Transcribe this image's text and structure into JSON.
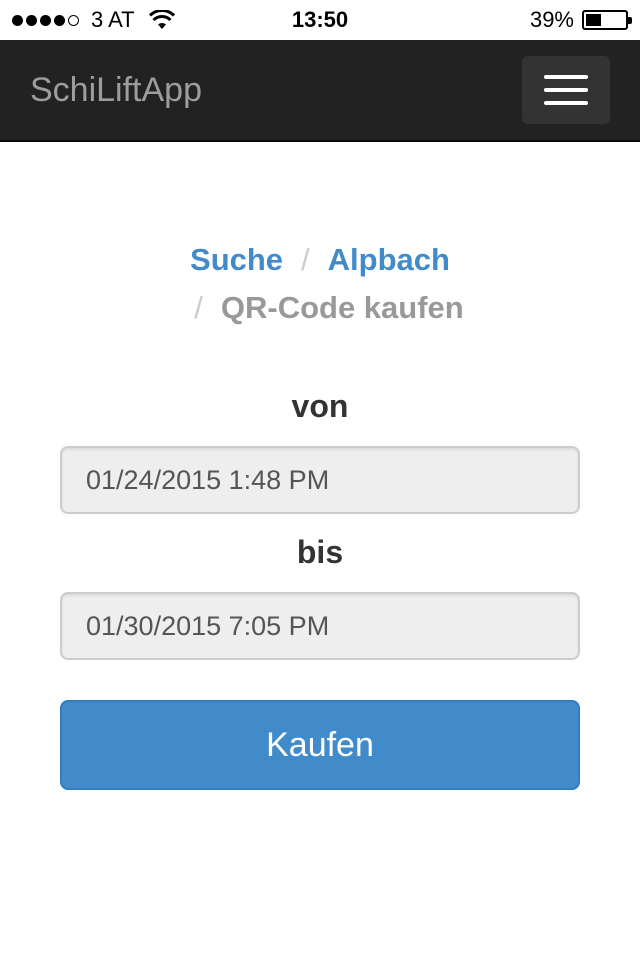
{
  "status_bar": {
    "carrier": "3 AT",
    "signal_bars_filled": 4,
    "signal_bars_total": 5,
    "time": "13:50",
    "battery_percent": "39%",
    "battery_level": 0.39,
    "wifi_icon": "wifi-icon"
  },
  "navbar": {
    "brand": "SchiLiftApp",
    "menu_icon": "hamburger-menu-icon",
    "background": "#222222"
  },
  "breadcrumb": {
    "items": [
      {
        "label": "Suche"
      },
      {
        "label": "Alpbach"
      },
      {
        "label": "QR-Code kaufen"
      }
    ],
    "separator": "/",
    "link_color": "#428bca",
    "active_color": "#999999"
  },
  "form": {
    "from_label": "von",
    "from_value": "01/24/2015 1:48 PM",
    "to_label": "bis",
    "to_value": "01/30/2015 7:05 PM",
    "submit_label": "Kaufen",
    "button_color": "#428bca"
  }
}
